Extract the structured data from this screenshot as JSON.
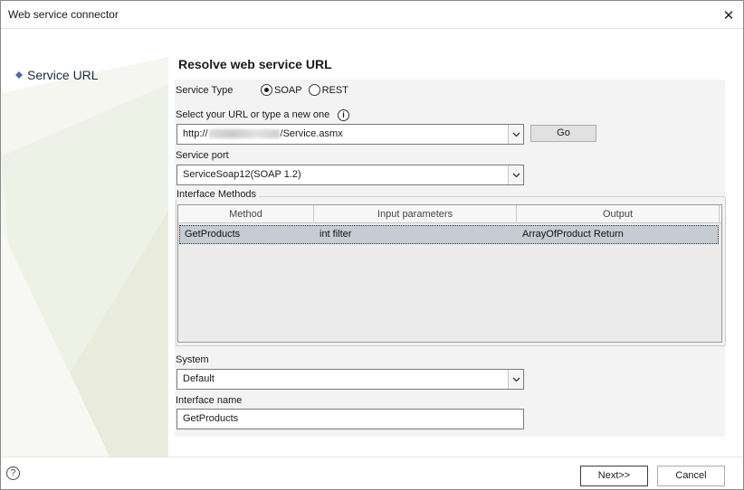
{
  "window": {
    "title": "Web service connector",
    "close_glyph": "✕"
  },
  "sidebar": {
    "items": [
      {
        "label": "Service URL",
        "icon": "diamond-bullet-icon"
      }
    ]
  },
  "main": {
    "heading": "Resolve web service URL",
    "service_type": {
      "label": "Service Type",
      "options": [
        {
          "label": "SOAP",
          "selected": true
        },
        {
          "label": "REST",
          "selected": false
        }
      ]
    },
    "url": {
      "label": "Select your URL or type a new one",
      "info_glyph": "i",
      "value_prefix": "http://",
      "value_suffix": "/Service.asmx",
      "go_label": "Go"
    },
    "service_port": {
      "label": "Service port",
      "value": "ServiceSoap12(SOAP 1.2)"
    },
    "interface_methods": {
      "title": "Interface Methods",
      "columns": [
        "Method",
        "Input parameters",
        "Output"
      ],
      "rows": [
        {
          "method": "GetProducts",
          "input": "int filter",
          "output": "ArrayOfProduct Return"
        }
      ]
    },
    "system": {
      "label": "System",
      "value": "Default"
    },
    "interface_name": {
      "label": "Interface name",
      "value": "GetProducts"
    }
  },
  "footer": {
    "help_glyph": "?",
    "next_label": "Next>>",
    "cancel_label": "Cancel"
  }
}
